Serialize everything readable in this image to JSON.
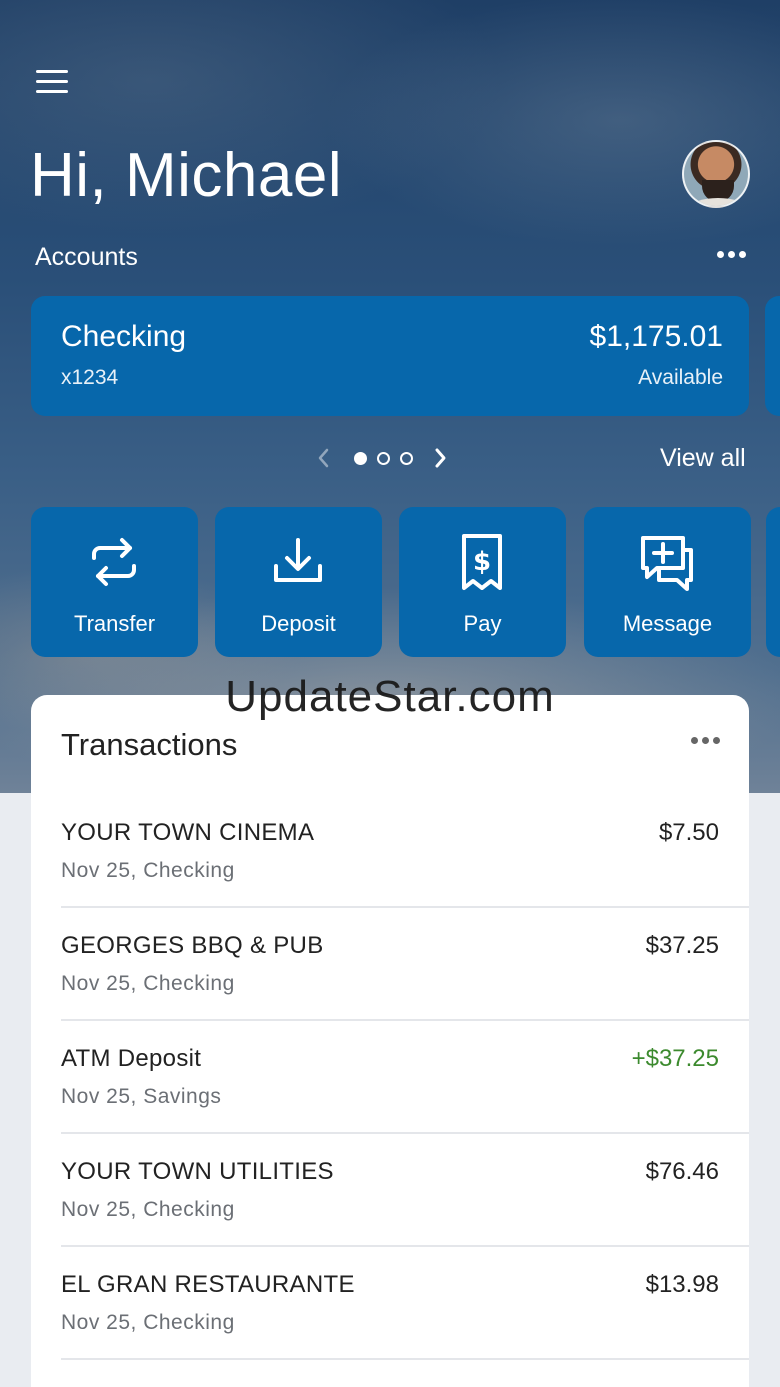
{
  "header": {
    "greeting": "Hi, Michael"
  },
  "accounts": {
    "label": "Accounts",
    "card": {
      "name": "Checking",
      "number": "x1234",
      "balance": "$1,175.01",
      "balance_label": "Available"
    },
    "pager": {
      "pages": 3,
      "active_index": 0
    },
    "view_all": "View all"
  },
  "actions": [
    {
      "label": "Transfer",
      "icon": "transfer-arrows-icon"
    },
    {
      "label": "Deposit",
      "icon": "deposit-download-icon"
    },
    {
      "label": "Pay",
      "icon": "pay-receipt-icon"
    },
    {
      "label": "Message",
      "icon": "message-bubble-icon"
    }
  ],
  "watermark": "UpdateStar.com",
  "transactions": {
    "title": "Transactions",
    "items": [
      {
        "name": "YOUR TOWN CINEMA",
        "sub": "Nov 25, Checking",
        "amount": "$7.50",
        "credit": false
      },
      {
        "name": "GEORGES BBQ & PUB",
        "sub": "Nov 25, Checking",
        "amount": "$37.25",
        "credit": false
      },
      {
        "name": "ATM Deposit",
        "sub": "Nov 25, Savings",
        "amount": "+$37.25",
        "credit": true
      },
      {
        "name": "YOUR TOWN UTILITIES",
        "sub": "Nov 25, Checking",
        "amount": "$76.46",
        "credit": false
      },
      {
        "name": "EL GRAN RESTAURANTE",
        "sub": "Nov 25, Checking",
        "amount": "$13.98",
        "credit": false
      }
    ]
  },
  "colors": {
    "card_blue": "#0767ab",
    "credit_green": "#3c8a2e"
  }
}
